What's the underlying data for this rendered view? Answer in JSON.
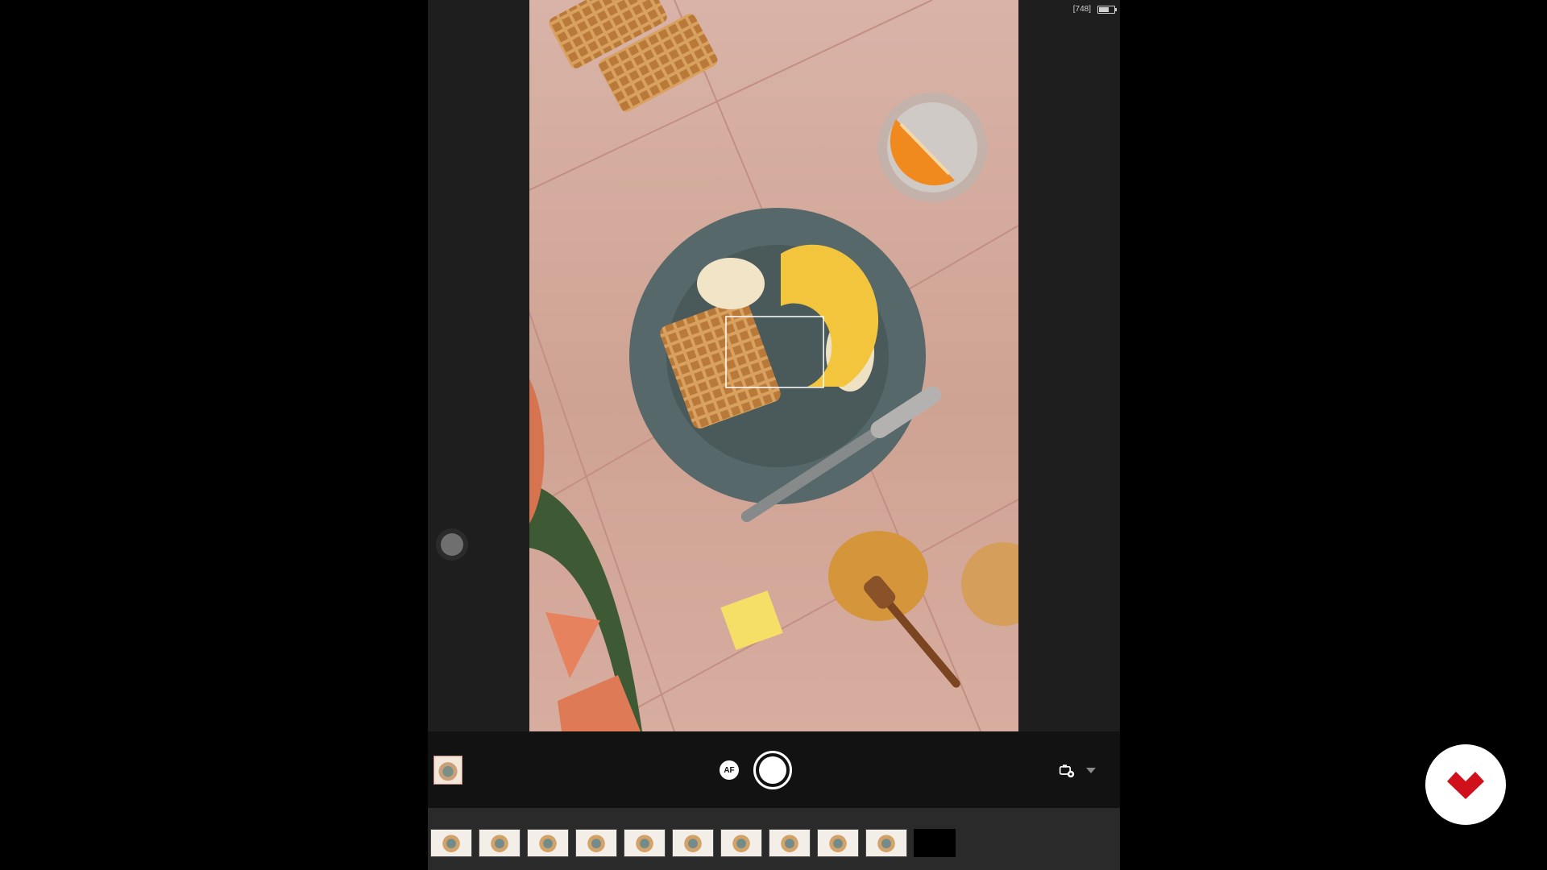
{
  "status": {
    "shots_remaining": "[748]",
    "battery_icon": "battery-icon"
  },
  "viewfinder": {
    "focus_box_icon": "focus-box-icon"
  },
  "controls": {
    "af_label": "AF",
    "shutter_icon": "shutter-icon",
    "settings_icon": "camera-settings-icon",
    "expand_icon": "chevron-down-icon",
    "last_photo_thumbnail": "last-photo-thumbnail"
  },
  "film_strip": {
    "frames": 10,
    "empty_frame": true
  },
  "brand": {
    "fab_icon": "heart-logo-icon",
    "colors": {
      "accent": "#d0111b",
      "background": "#1e1e1e"
    }
  }
}
